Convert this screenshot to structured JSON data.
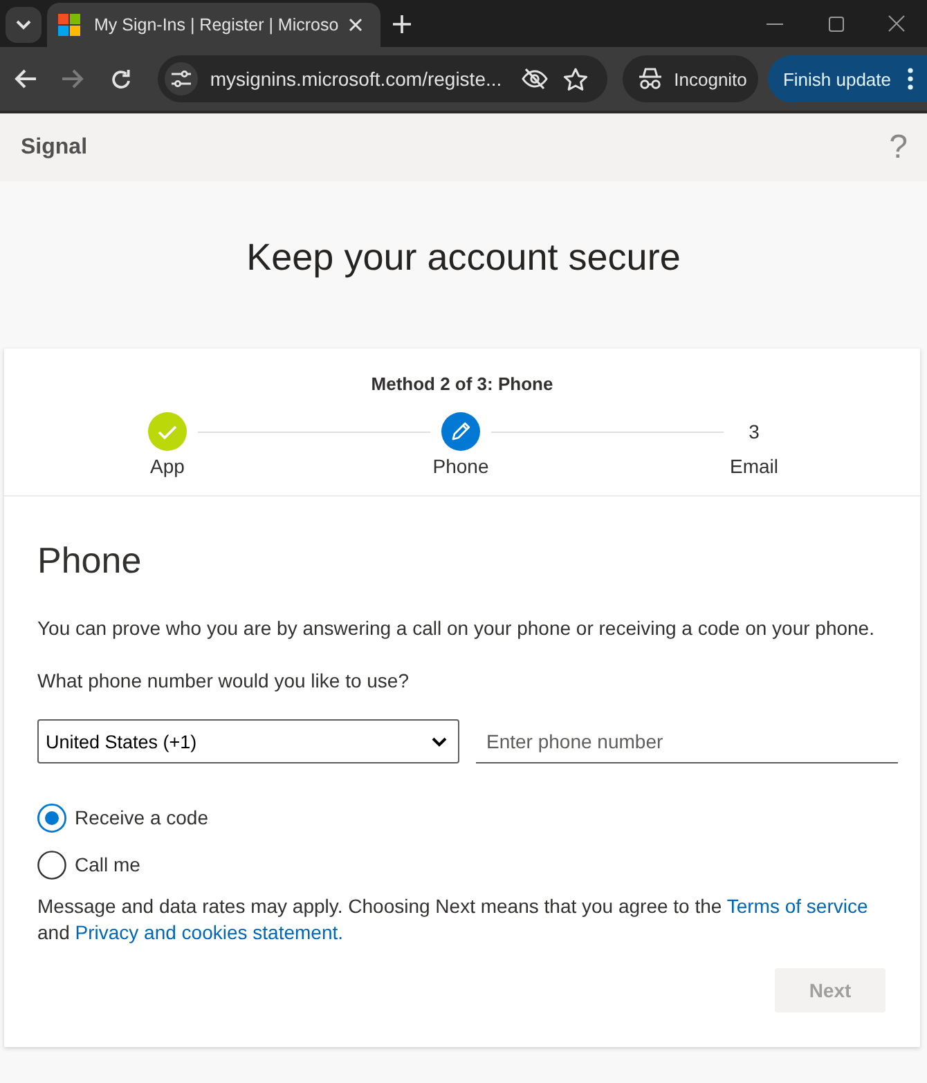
{
  "browser": {
    "tabs": [
      {
        "title": "My Sign-Ins | Register | Microso",
        "selected": true
      }
    ],
    "nav": [
      {
        "kind": "back",
        "disabled": false
      },
      {
        "kind": "forward",
        "disabled": true
      },
      {
        "kind": "reload",
        "disabled": false
      }
    ],
    "url": "mysignins.microsoft.com/registe...",
    "incognito": "Incognito",
    "update_button": "Finish update"
  },
  "header": {
    "title": "Signal",
    "help": "?"
  },
  "page_title": "Keep your account secure",
  "wizard": {
    "caption": "Method 2 of 3: Phone",
    "steps": [
      {
        "label": "App",
        "completed": true,
        "selected": false
      },
      {
        "label": "Phone",
        "completed": false,
        "selected": true
      },
      {
        "label": "Email",
        "number": "3",
        "completed": false,
        "selected": false
      }
    ]
  },
  "form": {
    "heading": "Phone",
    "intro": "You can prove who you are by answering a call on your phone or receiving a code on your phone.",
    "question": "What phone number would you like to use?",
    "country": "United States (+1)",
    "phone_placeholder": "Enter phone number",
    "options": [
      {
        "label": "Receive a code",
        "selected": true
      },
      {
        "label": "Call me",
        "selected": false
      }
    ],
    "disclaimer": [
      {
        "kind": "text",
        "text": "Message and data rates may apply. Choosing Next means that you agree to the "
      },
      {
        "kind": "link",
        "text": "Terms of service"
      },
      {
        "kind": "text",
        "text": " and "
      },
      {
        "kind": "link",
        "text": "Privacy and cookies statement."
      }
    ],
    "next_button": {
      "label": "Next",
      "disabled": true
    }
  }
}
